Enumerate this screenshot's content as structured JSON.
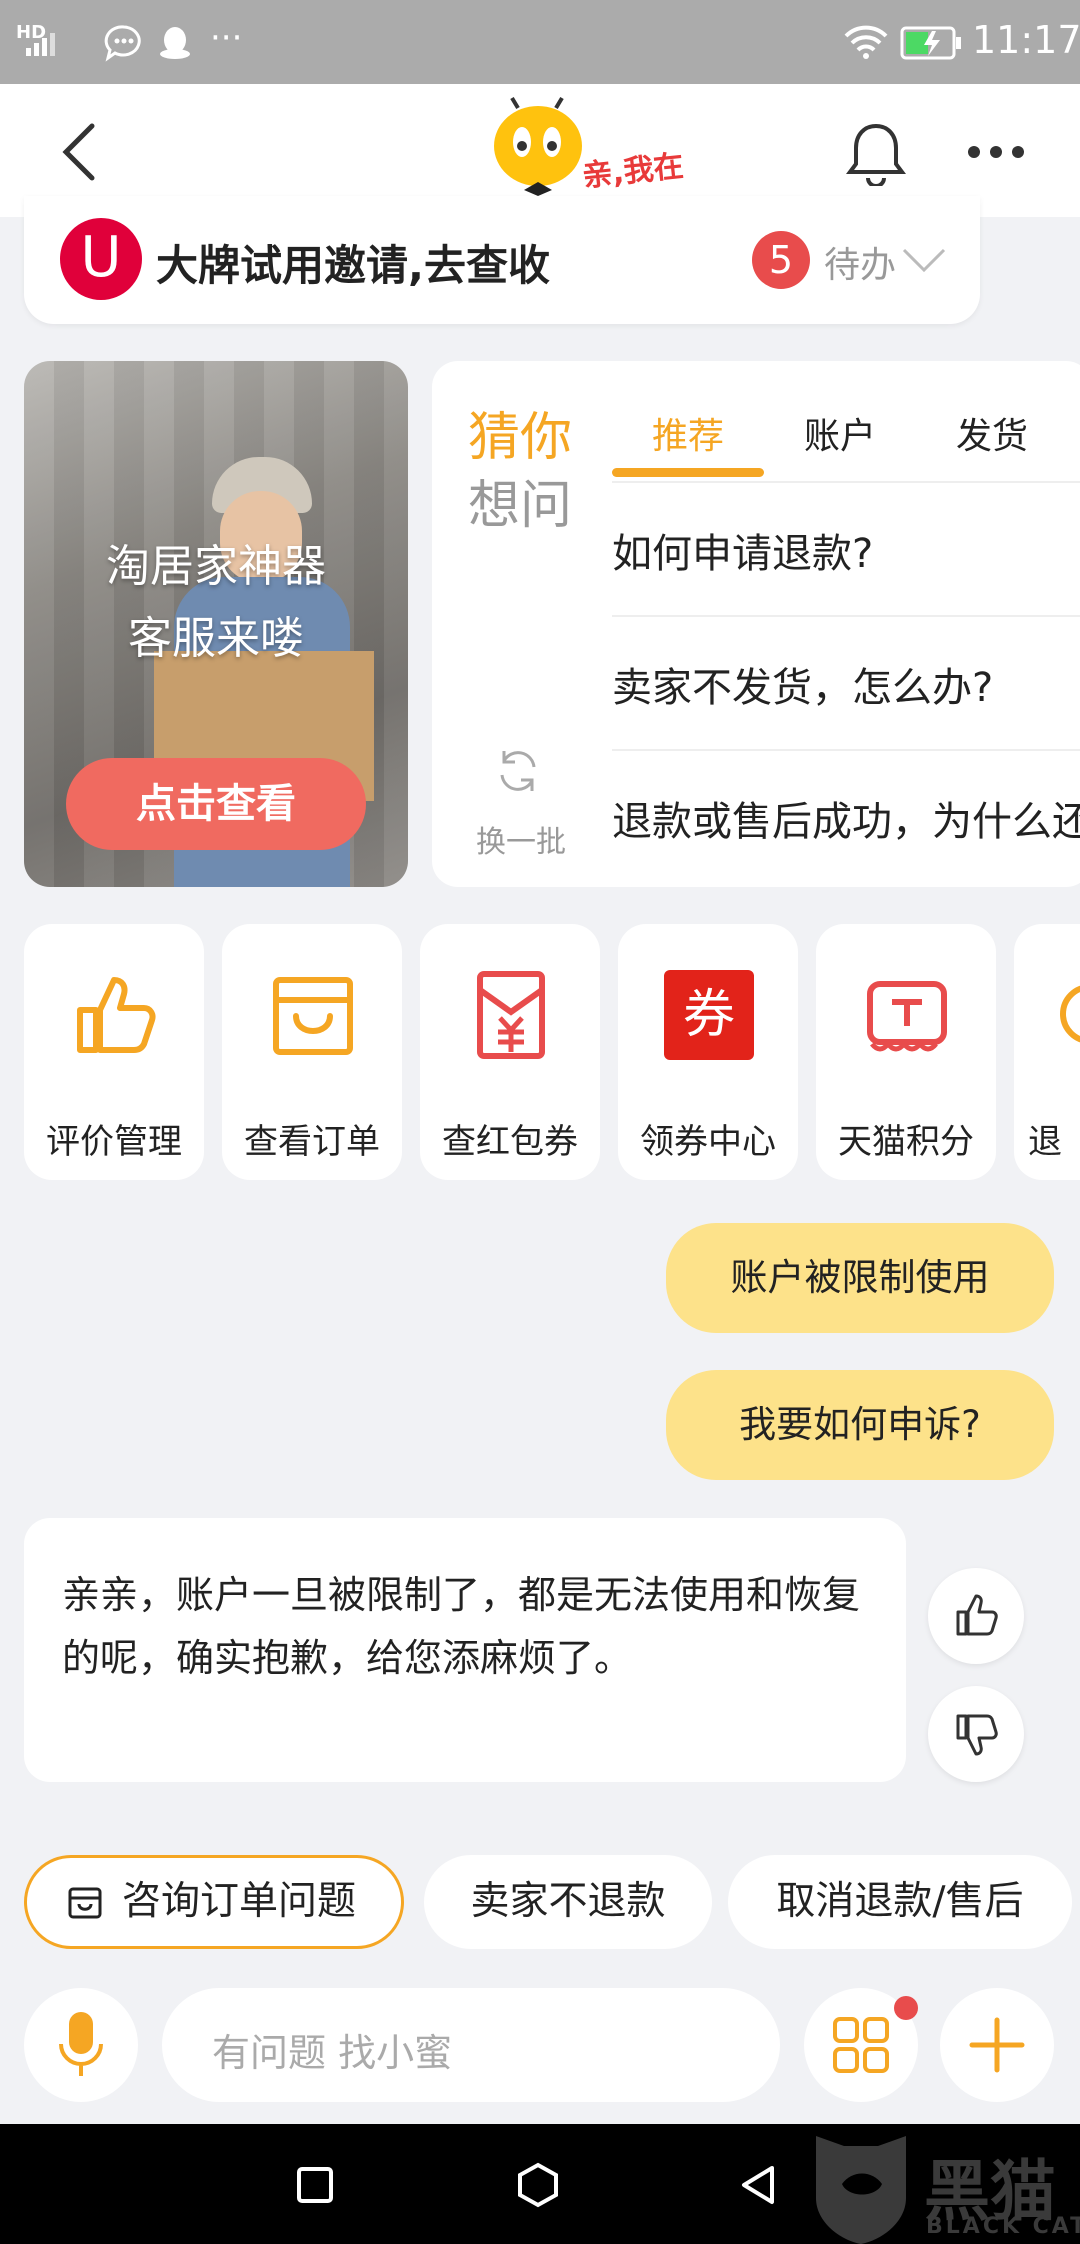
{
  "status_bar": {
    "network": "HD",
    "time": "11:17"
  },
  "notice": {
    "icon_letter": "U",
    "text": "大牌试用邀请,去查收",
    "badge_count": "5",
    "todo_label": "待办"
  },
  "promo": {
    "line1": "淘居家神器",
    "line2": "客服来喽",
    "button_label": "点击查看"
  },
  "faq": {
    "title_line1": "猜你",
    "title_line2": "想问",
    "tabs": [
      "推荐",
      "账户",
      "发货"
    ],
    "questions": [
      "如何申请退款?",
      "卖家不发货，怎么办?",
      "退款或售后成功，为什么还"
    ],
    "refresh_label": "换一批"
  },
  "shortcuts": [
    {
      "label": "评价管理",
      "icon": "thumbs-up-icon"
    },
    {
      "label": "查看订单",
      "icon": "shopping-bag-icon"
    },
    {
      "label": "查红包券",
      "icon": "red-packet-icon"
    },
    {
      "label": "领券中心",
      "icon": "coupon-icon",
      "icon_text": "券"
    },
    {
      "label": "天猫积分",
      "icon": "tmall-icon"
    },
    {
      "label": "退"
    }
  ],
  "chat": {
    "user_messages": [
      "账户被限制使用",
      "我要如何申诉?"
    ],
    "bot_reply": "亲亲，账户一旦被限制了，都是无法使用和恢复的呢，确实抱歉，给您添麻烦了。"
  },
  "quick_replies": [
    "咨询订单问题",
    "卖家不退款",
    "取消退款/售后"
  ],
  "input": {
    "placeholder": "有问题 找小蜜"
  },
  "logo": {
    "text": "亲,我在"
  },
  "watermark": {
    "text": "黑猫",
    "sub": "BLACK CAT"
  },
  "colors": {
    "accent": "#f5a623",
    "brand_red": "#e63a3a",
    "bubble": "#fde28a",
    "coral": "#f06a60"
  }
}
